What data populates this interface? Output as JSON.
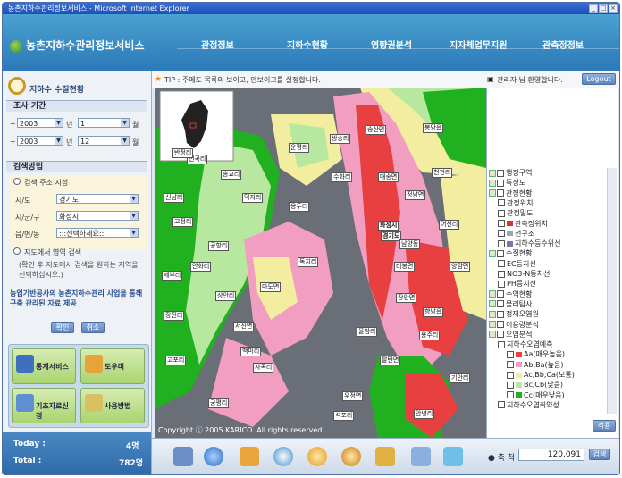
{
  "window": {
    "title": "농촌지하수관리정보서비스 - Microsoft Internet Explorer",
    "controls": [
      "_",
      "□",
      "×"
    ]
  },
  "header": {
    "logo_text": "농촌지하수관리정보서비스",
    "nav": [
      "관정정보",
      "지하수현황",
      "영향권분석",
      "지자체업무지원",
      "관측정정보"
    ]
  },
  "left": {
    "title": "지하수 수질현황",
    "survey_section": "조사 기간",
    "from": {
      "year": "2003",
      "year_suffix": "년",
      "month": "1",
      "month_suffix": "월"
    },
    "to": {
      "year": "2003",
      "year_suffix": "년",
      "month": "12",
      "month_suffix": "월"
    },
    "search_section": "검색방법",
    "addr_radio": "검색 주소 지정",
    "sido_label": "시/도",
    "sido_value": "경기도",
    "sigungu_label": "시/군/구",
    "sigungu_value": "화성시",
    "emd_label": "읍/면/동",
    "emd_value": ":::선택하세요:::",
    "map_radio": "지도에서 영역 검색",
    "map_hint": "(확인 후 지도에서 검색을 원하는 지역을 선택하십시오.)",
    "notice": "농업기반공사의 농촌지하수관리 사업을 통해 구축 관리된 자료 제공",
    "confirm": "확인",
    "cancel": "취소",
    "shortcuts": [
      "통계서비스",
      "도우미",
      "기초자료신청",
      "사용방법"
    ],
    "stats": [
      {
        "label": "Today :",
        "value": "4명"
      },
      {
        "label": "Total :",
        "value": "782명"
      }
    ]
  },
  "tipbar": {
    "tip": "TIP : 주메도 목록의 보이고, 안보이고를 설정합니다.",
    "greeting": "관리자 님 환영합니다.",
    "logout": "Logout"
  },
  "map": {
    "copyright": "Copyright ⓒ 2005 KARICO. All rights reserved.",
    "labels": [
      {
        "t": "화성시",
        "k": "city"
      },
      {
        "t": "경기도",
        "k": "city"
      },
      {
        "t": "남양동",
        "k": "name"
      },
      {
        "t": "송산면",
        "k": "name"
      },
      {
        "t": "마도면",
        "k": "name"
      },
      {
        "t": "서신면",
        "k": "name"
      },
      {
        "t": "우정면",
        "k": "name"
      },
      {
        "t": "장안면",
        "k": "name"
      },
      {
        "t": "향남읍",
        "k": "name"
      },
      {
        "t": "정남면",
        "k": "name"
      },
      {
        "t": "봉담읍",
        "k": "name"
      },
      {
        "t": "매송면",
        "k": "name"
      },
      {
        "t": "팔탄면",
        "k": "name"
      },
      {
        "t": "양감면",
        "k": "name"
      },
      {
        "t": "비봉면",
        "k": "name"
      },
      {
        "t": "신남리",
        "k": "name"
      },
      {
        "t": "고정리",
        "k": "name"
      },
      {
        "t": "공항리",
        "k": "name"
      },
      {
        "t": "덕지리",
        "k": "name"
      },
      {
        "t": "안화리",
        "k": "name"
      },
      {
        "t": "상안리",
        "k": "name"
      },
      {
        "t": "백미리",
        "k": "name"
      },
      {
        "t": "사곡리",
        "k": "name"
      },
      {
        "t": "궁평리",
        "k": "name"
      },
      {
        "t": "장전리",
        "k": "name"
      },
      {
        "t": "고포리",
        "k": "name"
      },
      {
        "t": "송교리",
        "k": "name"
      },
      {
        "t": "전곡리",
        "k": "name"
      },
      {
        "t": "제부리",
        "k": "name"
      },
      {
        "t": "독지리",
        "k": "name"
      },
      {
        "t": "운평리",
        "k": "name"
      },
      {
        "t": "쌍송리",
        "k": "name"
      },
      {
        "t": "용두리",
        "k": "name"
      },
      {
        "t": "수화리",
        "k": "name"
      },
      {
        "t": "어천리",
        "k": "name"
      },
      {
        "t": "천천리",
        "k": "name"
      },
      {
        "t": "율암리",
        "k": "name"
      },
      {
        "t": "석포리",
        "k": "name"
      },
      {
        "t": "기안리",
        "k": "name"
      },
      {
        "t": "안녕리",
        "k": "name"
      },
      {
        "t": "반정리",
        "k": "name"
      },
      {
        "t": "용주리",
        "k": "name"
      }
    ]
  },
  "legend": {
    "items": [
      {
        "t": "행정구역",
        "lvl": 0,
        "type": "group"
      },
      {
        "t": "특정도",
        "lvl": 0,
        "type": "group"
      },
      {
        "t": "관정현황",
        "lvl": 0,
        "type": "group"
      },
      {
        "t": "관정위치",
        "lvl": 1,
        "type": "layer"
      },
      {
        "t": "관정밀도",
        "lvl": 1,
        "type": "layer"
      },
      {
        "t": "관측정위치",
        "lvl": 1,
        "type": "layer",
        "sw": "#e03030"
      },
      {
        "t": "선구조",
        "lvl": 1,
        "type": "layer",
        "sw": "#9aa"
      },
      {
        "t": "지하수등수위선",
        "lvl": 1,
        "type": "layer",
        "sw": "#77a"
      },
      {
        "t": "수질현황",
        "lvl": 0,
        "type": "group"
      },
      {
        "t": "EC등치선",
        "lvl": 1,
        "type": "layer"
      },
      {
        "t": "NO3-N등치선",
        "lvl": 1,
        "type": "layer"
      },
      {
        "t": "PH등치선",
        "lvl": 1,
        "type": "layer"
      },
      {
        "t": "수역현황",
        "lvl": 0,
        "type": "group"
      },
      {
        "t": "물리탐사",
        "lvl": 0,
        "type": "group"
      },
      {
        "t": "정재오염원",
        "lvl": 0,
        "type": "group"
      },
      {
        "t": "이용량분석",
        "lvl": 0,
        "type": "group"
      },
      {
        "t": "오염분석",
        "lvl": 0,
        "type": "group"
      },
      {
        "t": "지하수오염예측",
        "lvl": 1,
        "type": "layer"
      },
      {
        "t": "Aa(매우높음)",
        "lvl": 2,
        "type": "sw",
        "sw": "#e84040"
      },
      {
        "t": "Ab,Ba(높음)",
        "lvl": 2,
        "type": "sw",
        "sw": "#f29ec0"
      },
      {
        "t": "Ac,Bb,Ca(보통)",
        "lvl": 2,
        "type": "sw",
        "sw": "#f3eda0"
      },
      {
        "t": "Bc,Cb(낮음)",
        "lvl": 2,
        "type": "sw",
        "sw": "#b8e8a0"
      },
      {
        "t": "Cc(매우낮음)",
        "lvl": 2,
        "type": "sw",
        "sw": "#20b020"
      },
      {
        "t": "지하수오염취약성",
        "lvl": 1,
        "type": "layer"
      }
    ],
    "apply": "적용"
  },
  "toolbar": {
    "scale_label": "축 척",
    "scale_value": "120,091",
    "scale_button": "검색"
  },
  "colors": {
    "very_high": "#e84040",
    "high": "#f29ec0",
    "medium": "#f3eda0",
    "low": "#b8e8a0",
    "very_low": "#20b020",
    "water": "#6a6e76",
    "header": "#2b78b8"
  }
}
